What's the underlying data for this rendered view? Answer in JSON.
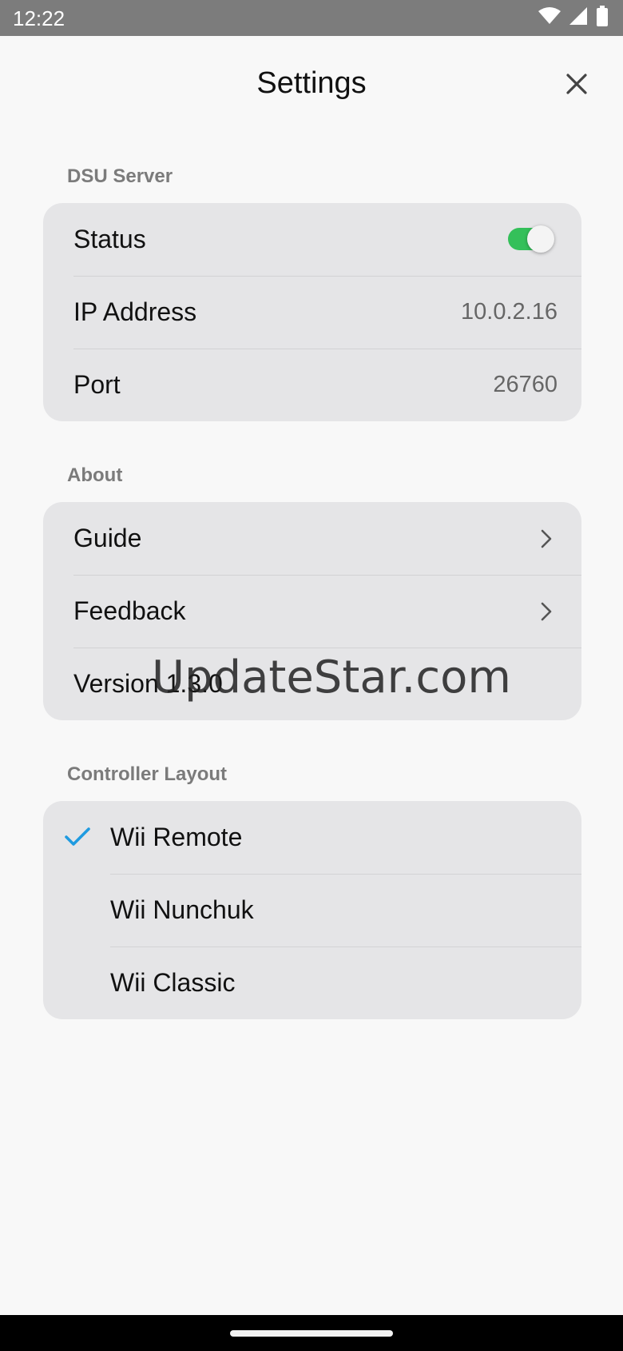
{
  "status_bar": {
    "time": "12:22",
    "icons": [
      "wifi-icon",
      "cellular-signal-icon",
      "battery-icon"
    ]
  },
  "header": {
    "title": "Settings",
    "close_icon": "close-icon"
  },
  "dsu_server": {
    "section_title": "DSU Server",
    "status_label": "Status",
    "status_on": true,
    "ip_label": "IP Address",
    "ip_value": "10.0.2.16",
    "port_label": "Port",
    "port_value": "26760"
  },
  "about": {
    "section_title": "About",
    "guide_label": "Guide",
    "feedback_label": "Feedback",
    "version_label": "Version 1.3.0"
  },
  "controller_layout": {
    "section_title": "Controller Layout",
    "options": [
      "Wii Remote",
      "Wii Nunchuk",
      "Wii Classic"
    ],
    "selected": "Wii Remote"
  },
  "watermark": "UpdateStar.com",
  "colors": {
    "toggle_on": "#34c05a",
    "checkmark": "#1f9be0",
    "card_background": "#e5e5e7",
    "page_background": "#f8f8f8",
    "section_header": "#7b7b7b"
  }
}
